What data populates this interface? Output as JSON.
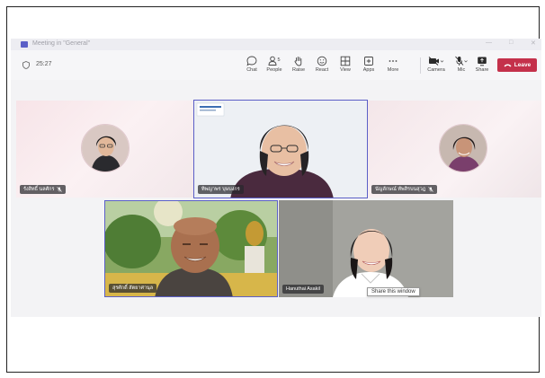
{
  "window": {
    "title": "Meeting in \"General\"",
    "controls": [
      "—",
      "□",
      "✕"
    ]
  },
  "toolbar": {
    "timer": "25:27",
    "buttons": [
      {
        "label": "Chat",
        "icon": "chat-icon"
      },
      {
        "label": "People",
        "icon": "people-icon",
        "count": "5"
      },
      {
        "label": "Raise",
        "icon": "raise-hand-icon"
      },
      {
        "label": "React",
        "icon": "react-smiley-icon"
      },
      {
        "label": "View",
        "icon": "view-grid-icon"
      },
      {
        "label": "Apps",
        "icon": "apps-icon"
      },
      {
        "label": "More",
        "icon": "more-icon"
      },
      {
        "label": "Camera",
        "icon": "camera-off-icon"
      },
      {
        "label": "Mic",
        "icon": "mic-off-icon"
      },
      {
        "label": "Share",
        "icon": "share-icon"
      }
    ],
    "leave_label": "Leave"
  },
  "participants": [
    {
      "name": "รังสิทธิ์ นลศักร",
      "muted": true
    },
    {
      "name": "ทิพญาพร บุษบงกร",
      "muted": false
    },
    {
      "name": "นัญลักษณ์ ทัพสิรบนสุวฎ",
      "muted": true
    },
    {
      "name": "สุรศักดิ์ สัตยาศานุล",
      "muted": false
    },
    {
      "name": "Hanuthai Asakil",
      "muted": false
    }
  ],
  "tooltip": "Share this window",
  "colors": {
    "accent": "#5b5fc7",
    "leave": "#c4314b"
  }
}
